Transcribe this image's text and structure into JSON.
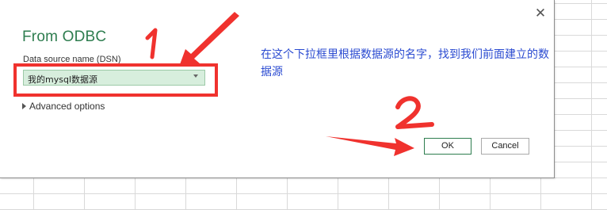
{
  "dialog": {
    "title": "From ODBC",
    "close_glyph": "✕",
    "dsn_label": "Data source name (DSN)",
    "dsn_value": "我的mysql数据源",
    "advanced_label": "Advanced options",
    "ok_label": "OK",
    "cancel_label": "Cancel"
  },
  "annotation": {
    "instruction_line1": "在这个下拉框里根据数据源的名字，找到我们前面建立的数",
    "instruction_line2": "据源",
    "marker_1": "1",
    "marker_2": "2",
    "color": "#f0322e"
  },
  "colors": {
    "title_green": "#2e7d4f",
    "select_bg": "#d7eedd",
    "annotation_text": "#2b4bd1"
  }
}
